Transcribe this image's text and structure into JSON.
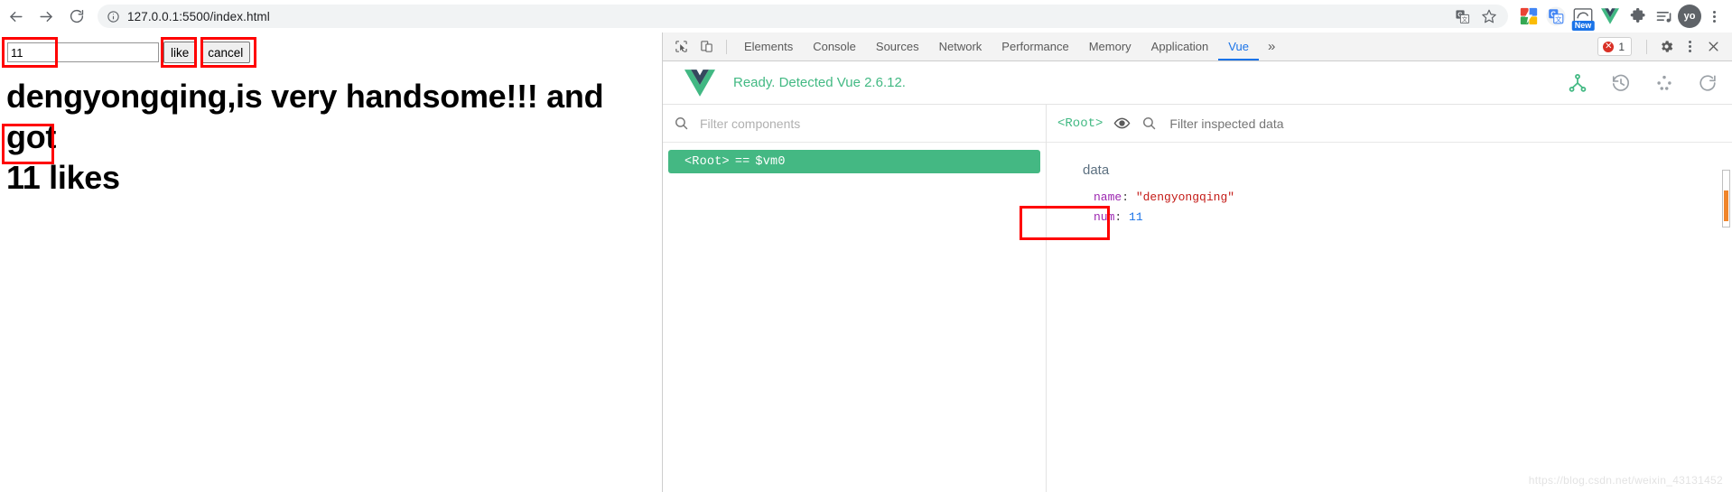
{
  "browser": {
    "back_icon": "back-arrow-icon",
    "forward_icon": "forward-arrow-icon",
    "reload_icon": "reload-icon",
    "omnibox": {
      "url": "127.0.0.1:5500/index.html",
      "site_info_icon": "site-info-icon",
      "translate_icon": "translate-icon",
      "bookmark_icon": "star-icon"
    },
    "extensions": [
      {
        "name": "extension-colorful",
        "glyph": ""
      },
      {
        "name": "google-translate-extension",
        "glyph": "G"
      },
      {
        "name": "snipaste-extension",
        "glyph": "S",
        "badge": "New"
      },
      {
        "name": "vue-devtools-extension",
        "glyph": "V"
      },
      {
        "name": "extensions-puzzle",
        "glyph": ""
      },
      {
        "name": "playlist-extension",
        "glyph": ""
      }
    ],
    "profile_initials": "yo",
    "menu_icon": "kebab-menu-icon"
  },
  "page": {
    "input_value": "11",
    "input_placeholder": "",
    "like_button": "like",
    "cancel_button": "cancel",
    "heading_line1": "dengyongqing,is very handsome!!! and got",
    "heading_count": "11",
    "heading_line2_suffix": "likes"
  },
  "devtools": {
    "inspect_icon": "inspect-element-icon",
    "device_icon": "device-toolbar-icon",
    "tabs": [
      {
        "label": "Elements",
        "active": false
      },
      {
        "label": "Console",
        "active": false
      },
      {
        "label": "Sources",
        "active": false
      },
      {
        "label": "Network",
        "active": false
      },
      {
        "label": "Performance",
        "active": false
      },
      {
        "label": "Memory",
        "active": false
      },
      {
        "label": "Application",
        "active": false
      },
      {
        "label": "Vue",
        "active": true
      }
    ],
    "more_tabs_icon": "chevron-double-right-icon",
    "error_count": "1",
    "error_icon": "error-circle-icon",
    "settings_icon": "gear-icon",
    "kebab_icon": "kebab-menu-icon",
    "close_icon": "close-icon"
  },
  "vue_panel": {
    "logo_icon": "vue-logo-icon",
    "status": "Ready. Detected Vue 2.6.12.",
    "header_icons": [
      {
        "name": "components-tree-icon",
        "active": true
      },
      {
        "name": "history-clock-icon",
        "active": false
      },
      {
        "name": "settings-dots-icon",
        "active": false
      },
      {
        "name": "refresh-icon",
        "active": false
      }
    ],
    "components": {
      "filter_placeholder": "Filter components",
      "search_icon": "search-icon",
      "tree": [
        {
          "label": "<Root>",
          "instance": "$vm0",
          "selected": true
        }
      ]
    },
    "inspector": {
      "root_label": "<Root>",
      "eye_icon": "eye-icon",
      "search_icon": "search-icon",
      "filter_placeholder": "Filter inspected data",
      "group_title": "data",
      "rows": [
        {
          "key": "name",
          "value": "\"dengyongqing\"",
          "type": "string",
          "highlighted": false
        },
        {
          "key": "num",
          "value": "11",
          "type": "number",
          "highlighted": true
        }
      ]
    }
  },
  "annotations": {
    "color": "#ff0000",
    "boxes": [
      {
        "name": "annotation-input-box"
      },
      {
        "name": "annotation-like-button"
      },
      {
        "name": "annotation-cancel-button"
      },
      {
        "name": "annotation-heading-count"
      },
      {
        "name": "annotation-num-data-row"
      }
    ]
  },
  "watermark": "https://blog.csdn.net/weixin_43131452"
}
